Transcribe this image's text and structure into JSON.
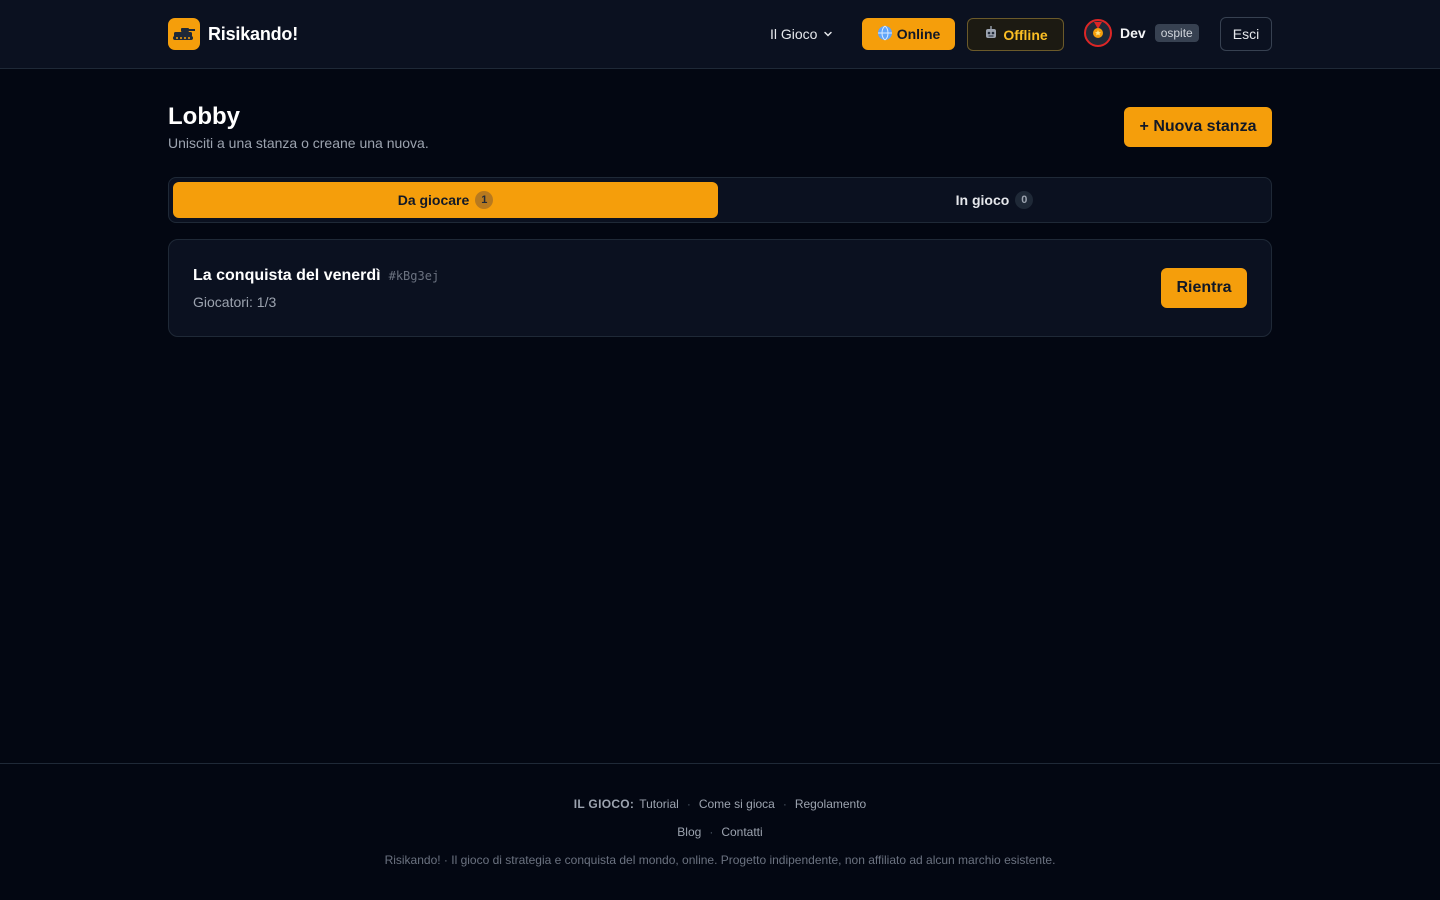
{
  "header": {
    "brand_name": "Risikando!",
    "nav_game": "Il Gioco",
    "online_label": "Online",
    "offline_label": "Offline",
    "user_name": "Dev",
    "guest_badge": "ospite",
    "logout_label": "Esci"
  },
  "main": {
    "title": "Lobby",
    "subtitle": "Unisciti a una stanza o creane una nuova.",
    "new_room_label": "+ Nuova stanza",
    "tabs": [
      {
        "label": "Da giocare",
        "count": "1",
        "active": true
      },
      {
        "label": "In gioco",
        "count": "0",
        "active": false
      }
    ],
    "rooms": [
      {
        "name": "La conquista del venerdì",
        "code": "#kBg3ej",
        "players": "Giocatori: 1/3",
        "action": "Rientra"
      }
    ]
  },
  "footer": {
    "section_label": "IL GIOCO:",
    "links_row1": [
      "Tutorial",
      "Come si gioca",
      "Regolamento"
    ],
    "links_row2": [
      "Blog",
      "Contatti"
    ],
    "copyright": "Risikando! · Il gioco di strategia e conquista del mondo, online. Progetto indipendente, non affiliato ad alcun marchio esistente."
  },
  "colors": {
    "accent": "#f59e0b",
    "background": "#030712",
    "surface": "#0b1120"
  },
  "icons": {
    "brand": "tank-icon",
    "online": "globe-icon",
    "offline": "robot-icon",
    "avatar": "medal-icon",
    "nav_game": "chevron-down-icon"
  }
}
